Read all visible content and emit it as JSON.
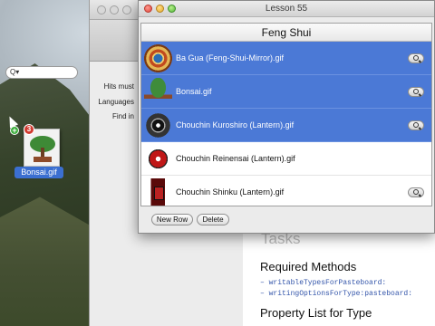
{
  "window": {
    "title": "Lesson 55"
  },
  "table": {
    "header": "Feng Shui",
    "rows": [
      {
        "label": "Ba Gua (Feng-Shui-Mirror).gif",
        "icon": "bagua-mirror-icon",
        "selected": true
      },
      {
        "label": "Bonsai.gif",
        "icon": "bonsai-icon",
        "selected": true
      },
      {
        "label": "Chouchin Kuroshiro (Lantern).gif",
        "icon": "lantern-kuroshiro-icon",
        "selected": true
      },
      {
        "label": "Chouchin Reinensai (Lantern).gif",
        "icon": "lantern-reinensai-icon",
        "selected": false
      },
      {
        "label": "Chouchin Shinku (Lantern).gif",
        "icon": "lantern-shinku-icon",
        "selected": false
      }
    ]
  },
  "buttons": {
    "new_row": "New Row",
    "delete": "Delete"
  },
  "background_window": {
    "search_placeholder": "Q▾",
    "labels": [
      "Hits must",
      "Languages",
      "Find in"
    ]
  },
  "docs": {
    "section_title": "Tasks",
    "heading1": "Required Methods",
    "methods": [
      "– writableTypesForPasteboard:",
      "– writingOptionsForType:pasteboard:"
    ],
    "heading2": "Property List for Type"
  },
  "desktop": {
    "file_label": "Bonsai.gif",
    "drag_count": "3",
    "drag_plus": "+"
  },
  "colors": {
    "selection": "#4b79d6",
    "label_selection": "#3b6fd1"
  }
}
